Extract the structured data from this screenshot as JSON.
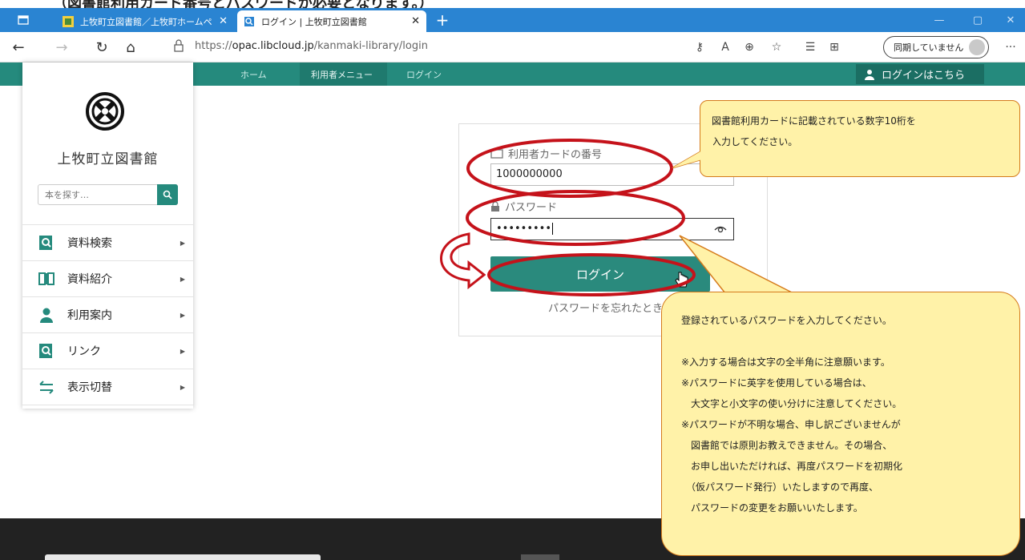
{
  "doc_heading": "（図書館利用カード番号とパスワードが必要となります。）",
  "browser": {
    "tabs": [
      {
        "title": "上牧町立図書館／上牧町ホームペ",
        "active": false
      },
      {
        "title": "ログイン | 上牧町立図書館",
        "active": true
      }
    ],
    "url_prefix": "https://",
    "url_host": "opac.libcloud.jp",
    "url_path": "/kanmaki-library/login",
    "sync_label": "同期していません",
    "colors": {
      "tabbar": "#2a84d2",
      "theme": "#258a7d"
    }
  },
  "header": {
    "breadcrumbs": [
      "ホーム",
      "利用者メニュー",
      "ログイン"
    ],
    "login_link": "ログインはこちら"
  },
  "sidebar": {
    "library_name": "上牧町立図書館",
    "search_placeholder": "本を探す…",
    "items": [
      {
        "label": "資料検索",
        "icon": "search-book-icon"
      },
      {
        "label": "資料紹介",
        "icon": "open-book-icon"
      },
      {
        "label": "利用案内",
        "icon": "person-icon"
      },
      {
        "label": "リンク",
        "icon": "link-search-icon"
      },
      {
        "label": "表示切替",
        "icon": "swap-arrows-icon"
      }
    ]
  },
  "login": {
    "card_label": "利用者カードの番号",
    "card_value": "1000000000",
    "password_label": "パスワード",
    "password_value": "•••••••••",
    "button_label": "ログイン",
    "forgot_label": "パスワードを忘れたとき"
  },
  "callouts": {
    "card": [
      "図書館利用カードに記載されている数字10桁を",
      "入力してください。"
    ],
    "password": [
      "登録されているパスワードを入力してください。",
      "",
      "※入力する場合は文字の全半角に注意願います。",
      "※パスワードに英字を使用している場合は、",
      "　大文字と小文字の使い分けに注意してください。",
      "※パスワードが不明な場合、申し訳ございませんが",
      "　図書館では原則お教えできません。その場合、",
      "　お申し出いただければ、再度パスワードを初期化",
      "　（仮パスワード発行）いたしますので再度、",
      "　パスワードの変更をお願いいたします。"
    ]
  }
}
